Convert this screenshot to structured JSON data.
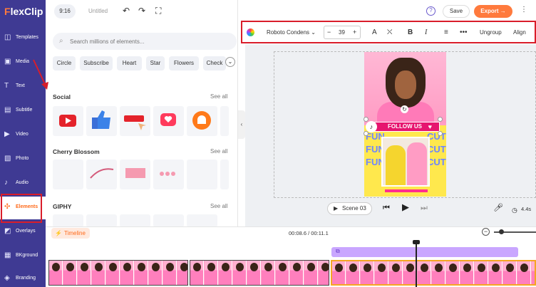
{
  "app": {
    "logo": "FlexClip",
    "ratio": "9:16",
    "title": "Untitled"
  },
  "header": {
    "save": "Save",
    "export": "Export →",
    "help": "?",
    "more": "⋮"
  },
  "sidebar": {
    "items": [
      {
        "label": "Templates",
        "icon": "templates-icon"
      },
      {
        "label": "Media",
        "icon": "media-icon"
      },
      {
        "label": "Text",
        "icon": "text-icon"
      },
      {
        "label": "Subtitle",
        "icon": "subtitle-icon"
      },
      {
        "label": "Video",
        "icon": "video-icon"
      },
      {
        "label": "Photo",
        "icon": "photo-icon"
      },
      {
        "label": "Audio",
        "icon": "audio-icon"
      },
      {
        "label": "Elements",
        "icon": "elements-icon",
        "active": true
      },
      {
        "label": "Overlays",
        "icon": "overlays-icon"
      },
      {
        "label": "BKground",
        "icon": "background-icon"
      },
      {
        "label": "Branding",
        "icon": "branding-icon"
      }
    ]
  },
  "panel": {
    "search_placeholder": "Search millions of elements...",
    "chips": [
      "Circle",
      "Subscribe",
      "Heart",
      "Star",
      "Flowers",
      "Check"
    ],
    "sections": [
      {
        "title": "Social",
        "see_all": "See all"
      },
      {
        "title": "Cherry Blossom",
        "see_all": "See all"
      },
      {
        "title": "GIPHY",
        "see_all": "See all"
      }
    ]
  },
  "format_toolbar": {
    "font": "Roboto Condens",
    "font_size": "39",
    "minus": "−",
    "plus": "+",
    "ungroup": "Ungroup",
    "align": "Align",
    "colors": {
      "border": "#d91d2a"
    }
  },
  "canvas": {
    "follow_label": "FOLLOW US",
    "fun_text": [
      "FUN",
      "FUN",
      "FUN"
    ],
    "cut_text": [
      "CUT",
      "CUT",
      "CUT"
    ]
  },
  "player": {
    "scene": "Scene 03",
    "duration": "4.4s"
  },
  "timeline": {
    "tab": "Timeline",
    "time": "00:08.6 / 00:11.1"
  },
  "colors": {
    "sidebar": "#3f3a93",
    "accent": "#ff7a3d",
    "annotation": "#d91d2a"
  }
}
